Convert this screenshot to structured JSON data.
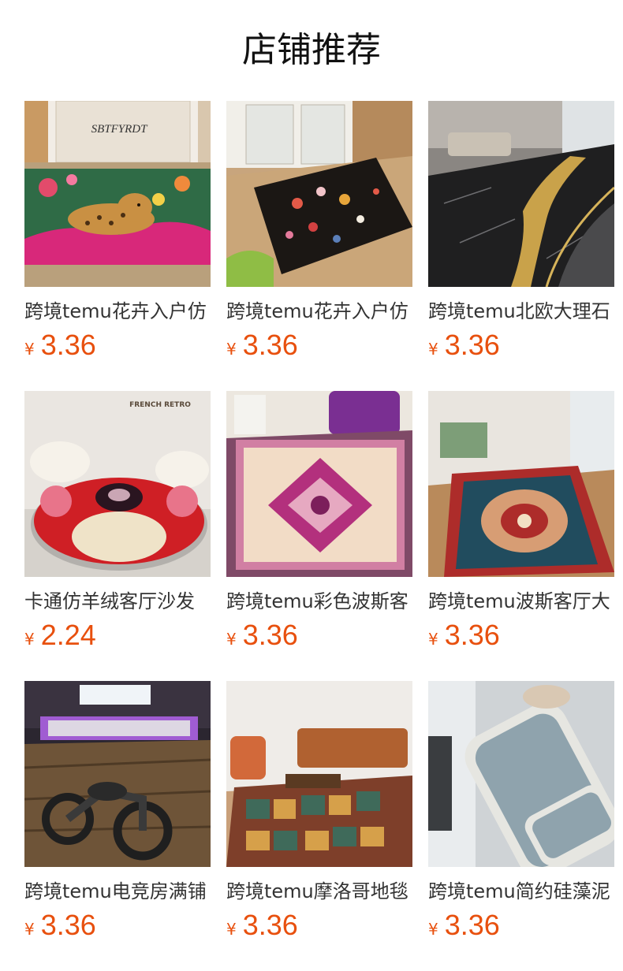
{
  "title": "店铺推荐",
  "currency": "¥",
  "products": [
    {
      "name": "跨境temu花卉入户仿",
      "price": "3.36",
      "image_icon": "leopard-floral-rug-image"
    },
    {
      "name": "跨境temu花卉入户仿",
      "price": "3.36",
      "image_icon": "black-floral-doormat-image"
    },
    {
      "name": "跨境temu北欧大理石",
      "price": "3.36",
      "image_icon": "marble-gold-rug-image"
    },
    {
      "name": "卡通仿羊绒客厅沙发",
      "price": "2.24",
      "image_icon": "cartoon-bear-round-rug-image"
    },
    {
      "name": "跨境temu彩色波斯客",
      "price": "3.36",
      "image_icon": "pink-persian-rug-image"
    },
    {
      "name": "跨境temu波斯客厅大",
      "price": "3.36",
      "image_icon": "blue-persian-rug-image"
    },
    {
      "name": "跨境temu电竞房满铺",
      "price": "3.36",
      "image_icon": "motorcycle-gaming-rug-image"
    },
    {
      "name": "跨境temu摩洛哥地毯",
      "price": "3.36",
      "image_icon": "moroccan-patchwork-rug-image"
    },
    {
      "name": "跨境temu简约硅藻泥",
      "price": "3.36",
      "image_icon": "diatom-kitchen-mat-image"
    }
  ],
  "image_text": {
    "brand_1": "SBTFYRDT",
    "brand_4": "FRENCH RETRO"
  },
  "colors": {
    "price": "#e8500e",
    "title": "#111111"
  }
}
